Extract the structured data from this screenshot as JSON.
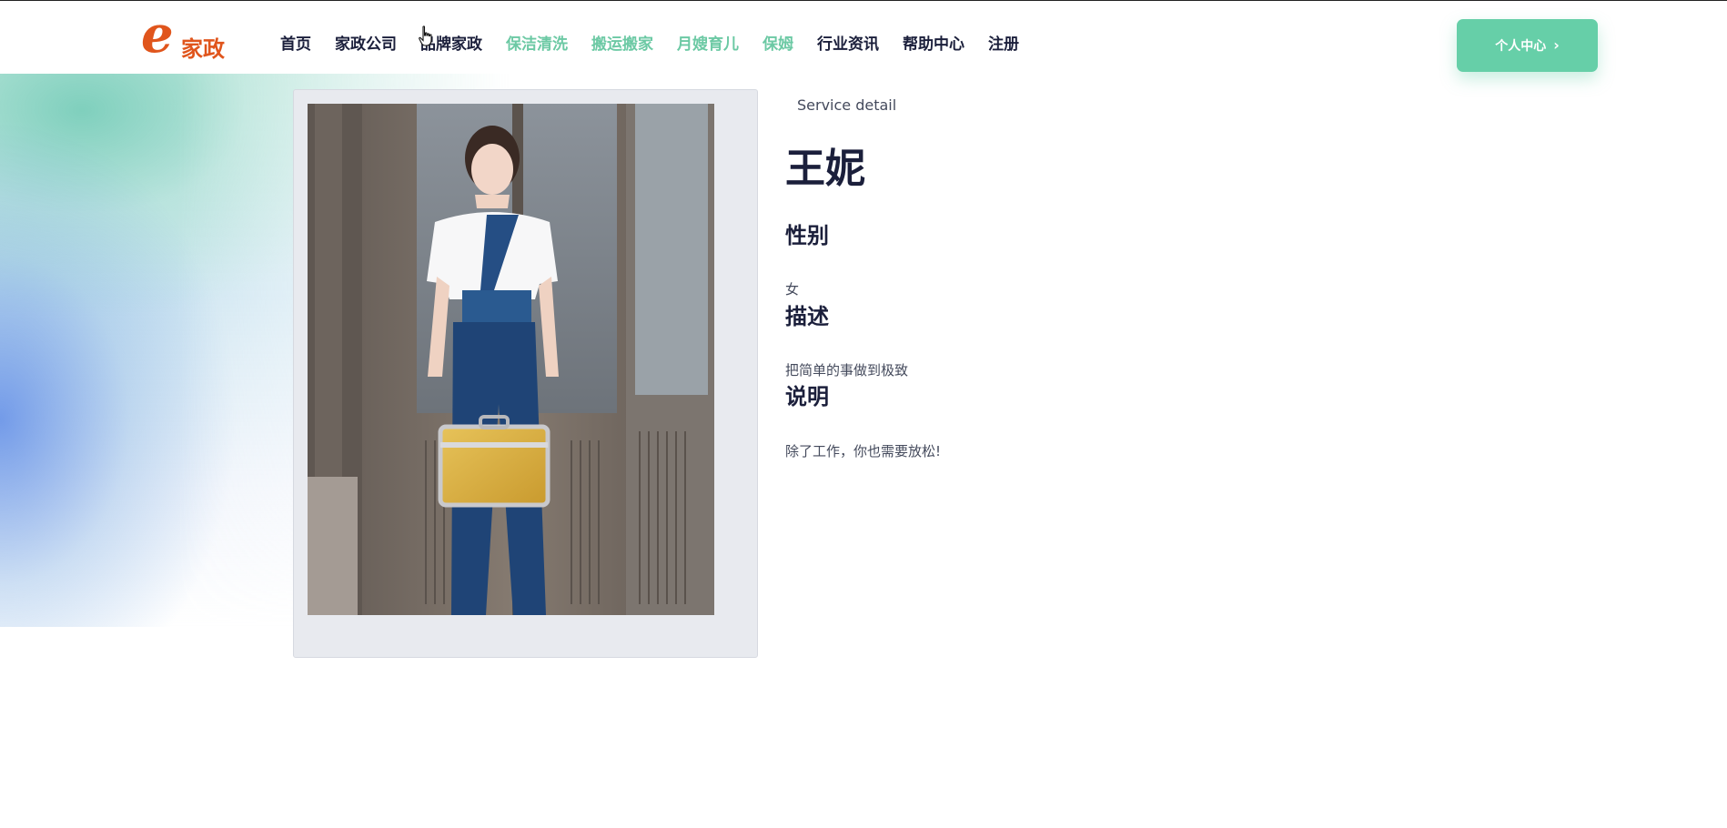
{
  "header": {
    "logo_letter": "e",
    "logo_text": "家政",
    "nav": [
      {
        "label": "首页",
        "active": false
      },
      {
        "label": "家政公司",
        "active": false
      },
      {
        "label": "品牌家政",
        "active": false
      },
      {
        "label": "保洁清洗",
        "active": true
      },
      {
        "label": "搬运搬家",
        "active": true
      },
      {
        "label": "月嫂育儿",
        "active": true
      },
      {
        "label": "保姆",
        "active": true
      },
      {
        "label": "行业资讯",
        "active": false
      },
      {
        "label": "帮助中心",
        "active": false
      },
      {
        "label": "注册",
        "active": false
      }
    ],
    "personal_center": "个人中心",
    "personal_center_icon": "chevron-right-icon"
  },
  "detail": {
    "eyebrow": "Service detail",
    "name": "王妮",
    "gender_label": "性别",
    "gender_value": "女",
    "description_label": "描述",
    "description_value": "把简单的事做到极致",
    "note_label": "说明",
    "note_value": "除了工作，你也需要放松!"
  },
  "colors": {
    "accent": "#66cfa8",
    "nav_active": "#6cc9a4",
    "logo": "#e0551c",
    "text_dark": "#1b1f3b"
  }
}
